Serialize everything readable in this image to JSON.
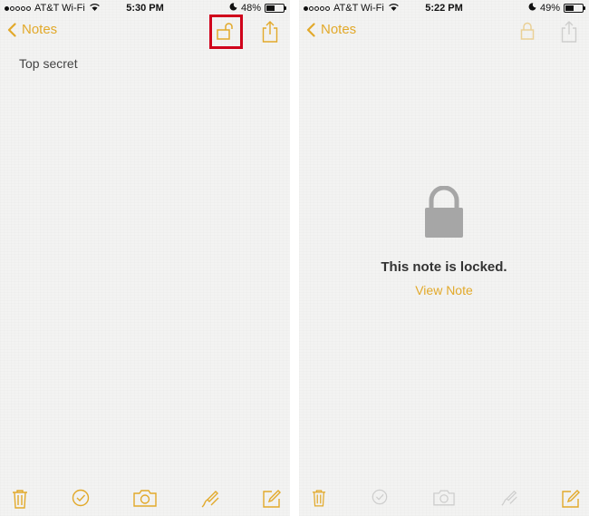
{
  "left_screen": {
    "status": {
      "carrier": "AT&T Wi-Fi",
      "time": "5:30 PM",
      "battery": "48%",
      "battery_level": 0.48
    },
    "nav": {
      "back_label": "Notes"
    },
    "note": {
      "text": "Top secret"
    },
    "icons": [
      "chevron-left-icon",
      "unlocked-icon",
      "share-icon",
      "trash-icon",
      "checklist-icon",
      "camera-icon",
      "sketch-icon",
      "compose-icon"
    ]
  },
  "right_screen": {
    "status": {
      "carrier": "AT&T Wi-Fi",
      "time": "5:22 PM",
      "battery": "49%",
      "battery_level": 0.49
    },
    "nav": {
      "back_label": "Notes"
    },
    "locked": {
      "title": "This note is locked.",
      "link": "View Note"
    },
    "icons": [
      "chevron-left-icon",
      "lock-icon",
      "share-icon",
      "trash-icon",
      "checklist-icon",
      "camera-icon",
      "sketch-icon",
      "compose-icon"
    ]
  },
  "colors": {
    "accent": "#e2a92a",
    "highlight": "#d0021b",
    "lock_gray": "#a6a6a6",
    "paper": "#f3f3f2"
  }
}
